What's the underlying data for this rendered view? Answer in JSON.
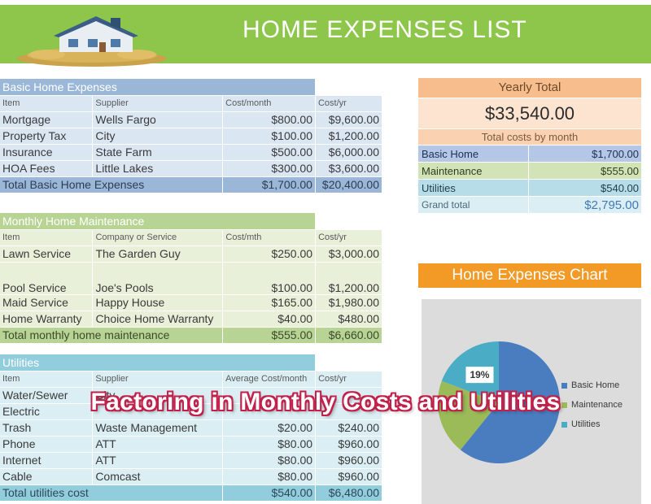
{
  "header": {
    "title": "HOME EXPENSES LIST"
  },
  "basic": {
    "title": "Basic Home Expenses",
    "headers": [
      "Item",
      "Supplier",
      "Cost/month",
      "Cost/yr"
    ],
    "rows": [
      [
        "Mortgage",
        "Wells Fargo",
        "$800.00",
        "$9,600.00"
      ],
      [
        "Property Tax",
        "City",
        "$100.00",
        "$1,200.00"
      ],
      [
        "Insurance",
        "State Farm",
        "$500.00",
        "$6,000.00"
      ],
      [
        "HOA Fees",
        "Little Lakes",
        "$300.00",
        "$3,600.00"
      ]
    ],
    "total": [
      "Total Basic Home Expenses",
      "$1,700.00",
      "$20,400.00"
    ]
  },
  "maintenance": {
    "title": "Monthly Home Maintenance",
    "headers": [
      "Item",
      "Company or Service",
      "Cost/mth",
      "Cost/yr"
    ],
    "rows": [
      [
        "Lawn Service",
        "The Garden Guy",
        "$250.00",
        "$3,000.00"
      ],
      [
        "Pool Service",
        "Joe's Pools",
        "$100.00",
        "$1,200.00"
      ],
      [
        "Maid Service",
        "Happy House",
        "$165.00",
        "$1,980.00"
      ],
      [
        "Home Warranty",
        "Choice Home Warranty",
        "$40.00",
        "$480.00"
      ]
    ],
    "total": [
      "Total monthly home maintenance",
      "$555.00",
      "$6,660.00"
    ]
  },
  "utilities": {
    "title": "Utilities",
    "headers": [
      "Item",
      "Supplier",
      "Average Cost/month",
      "Cost/yr"
    ],
    "rows": [
      [
        "Water/Sewer",
        "City",
        "",
        ""
      ],
      [
        "Electric",
        "",
        "",
        ""
      ],
      [
        "Trash",
        "Waste Management",
        "$20.00",
        "$240.00"
      ],
      [
        "Phone",
        "ATT",
        "$80.00",
        "$960.00"
      ],
      [
        "Internet",
        "ATT",
        "$80.00",
        "$960.00"
      ],
      [
        "Cable",
        "Comcast",
        "$80.00",
        "$960.00"
      ]
    ],
    "total": [
      "Total utilities cost",
      "$540.00",
      "$6,480.00"
    ]
  },
  "summary": {
    "heading": "Yearly Total",
    "yearly_total": "$33,540.00",
    "sub_heading": "Total costs by month",
    "rows": [
      [
        "Basic Home",
        "$1,700.00"
      ],
      [
        "Maintenance",
        "$555.00"
      ],
      [
        "Utilities",
        "$540.00"
      ]
    ],
    "grand": [
      "Grand total",
      "$2,795.00"
    ]
  },
  "chart": {
    "title": "Home Expenses Chart",
    "slice_label": "19%",
    "legend": [
      "Basic Home",
      "Maintenance",
      "Utilities"
    ]
  },
  "chart_data": {
    "type": "pie",
    "title": "Home Expenses Chart",
    "categories": [
      "Basic Home",
      "Maintenance",
      "Utilities"
    ],
    "values": [
      1700,
      555,
      540
    ],
    "data_labels": [
      "",
      "",
      "19%"
    ],
    "colors": [
      "#4a7cc0",
      "#9bbb59",
      "#4bacc6"
    ],
    "legend_position": "right"
  },
  "overlay_caption": "Factoring in Monthly Costs and Utilities",
  "colors": {
    "banner": "#8dc64b",
    "chart_title": "#f29a25",
    "summary_head": "#f8bd8c",
    "overlay_outline": "#c0204a"
  }
}
